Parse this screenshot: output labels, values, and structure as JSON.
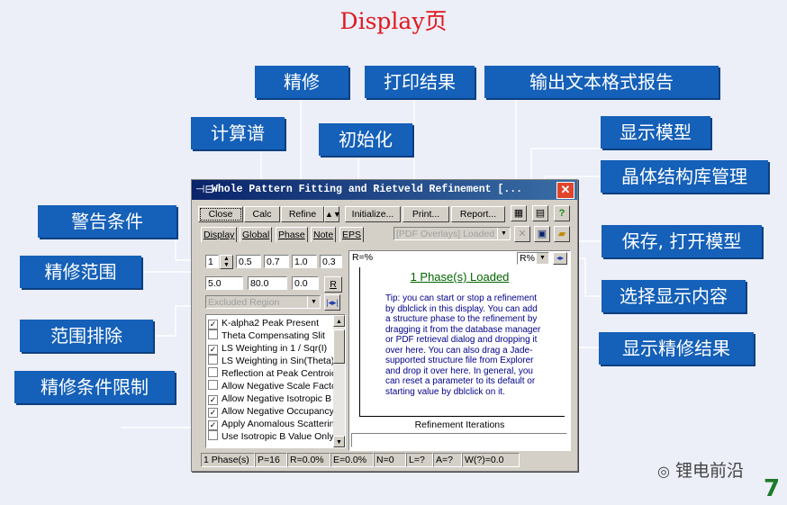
{
  "slide": {
    "title": "Display页",
    "page_number": "7",
    "watermark": "锂电前沿"
  },
  "callouts": {
    "refine": "精修",
    "print_result": "打印结果",
    "export_report": "输出文本格式报告",
    "calc_spectrum": "计算谱",
    "initialize": "初始化",
    "show_model": "显示模型",
    "crystal_db": "晶体结构库管理",
    "warning": "警告条件",
    "save_open": "保存, 打开模型",
    "refine_range": "精修范围",
    "display_select": "选择显示内容",
    "range_exclude": "范围排除",
    "show_result": "显示精修结果",
    "constraints": "精修条件限制"
  },
  "window": {
    "title": "Whole Pattern Fitting and Rietveld Refinement [...",
    "buttons": {
      "close": "Close",
      "calc": "Calc",
      "refine": "Refine",
      "initialize": "Initialize...",
      "print": "Print...",
      "report": "Report..."
    },
    "tabs": [
      "Display",
      "Global",
      "Phase",
      "Note",
      "EPS"
    ],
    "overlay_select": "[PDF Overlays] Loaded",
    "range": {
      "row1": [
        "1",
        "0.5",
        "0.7",
        "1.0",
        "0.3"
      ],
      "row2": [
        "5.0",
        "80.0",
        "0.0"
      ],
      "r_button": "R"
    },
    "excluded_region": "Excluded Region",
    "options": [
      {
        "label": "K-alpha2 Peak Present",
        "checked": true
      },
      {
        "label": "Theta Compensating Slit",
        "checked": false
      },
      {
        "label": "LS Weighting in 1 / Sqr(I)",
        "checked": true
      },
      {
        "label": "LS Weighting in Sin(Theta)",
        "checked": false
      },
      {
        "label": "Reflection at Peak Centroic",
        "checked": false
      },
      {
        "label": "Allow Negative Scale Factc",
        "checked": false
      },
      {
        "label": "Allow Negative Isotropic B",
        "checked": true
      },
      {
        "label": "Allow Negative Occupancy",
        "checked": true
      },
      {
        "label": "Apply Anomalous Scattering",
        "checked": true
      },
      {
        "label": "Use Isotropic B Value Only",
        "checked": false
      }
    ],
    "plot": {
      "y_label": "R=%",
      "select": "R%",
      "heading": "1 Phase(s) Loaded",
      "tip": "Tip: you can start or stop a refinement by dblclick in this display. You can add a structure phase to the refinement by dragging it from the database manager or PDF retrieval dialog and dropping it over here. You can also drag a Jade-supported structure file from Explorer and drop it over here. In general, you can reset a parameter to its default or starting value by dblclick on it.",
      "x_label": "Refinement Iterations"
    },
    "status": [
      "1 Phase(s)",
      "P=16",
      "R=0.0%",
      "E=0.0%",
      "N=0",
      "L=?",
      "A=?",
      "W(?)=0.0"
    ]
  }
}
